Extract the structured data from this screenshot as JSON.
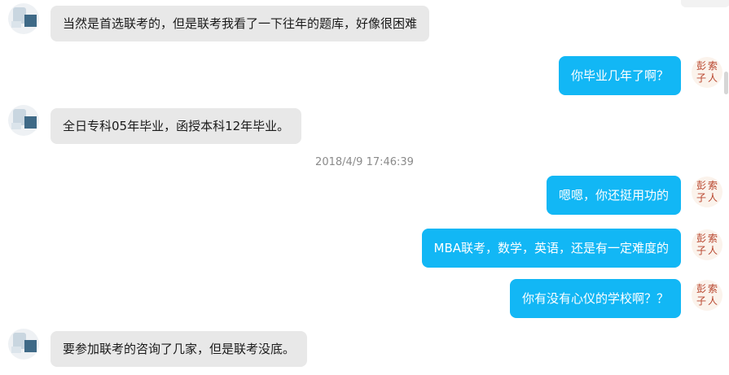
{
  "messages": [
    {
      "side": "left",
      "text": "当然是首选联考的，但是联考我看了一下往年的题库，好像很困难"
    },
    {
      "side": "right",
      "text": "你毕业几年了啊？"
    },
    {
      "side": "left",
      "text": "全日专科05年毕业，函授本科12年毕业。"
    },
    {
      "side": "right",
      "text": "嗯嗯，你还挺用功的"
    },
    {
      "side": "right",
      "text": "MBA联考，数学，英语，还是有一定难度的"
    },
    {
      "side": "right",
      "text": "你有没有心仪的学校啊？？"
    },
    {
      "side": "left",
      "text": "要参加联考的咨询了几家，但是联考没底。"
    }
  ],
  "timestamp": "2018/4/9 17:46:39",
  "colors": {
    "outgoing_bubble": "#12b7f5",
    "incoming_bubble": "#e8e8e8",
    "timestamp_text": "#8a8a8a"
  },
  "icons": {
    "left_avatar": "contact-avatar-icon",
    "right_avatar": "calligraphy-seal-avatar-icon"
  }
}
